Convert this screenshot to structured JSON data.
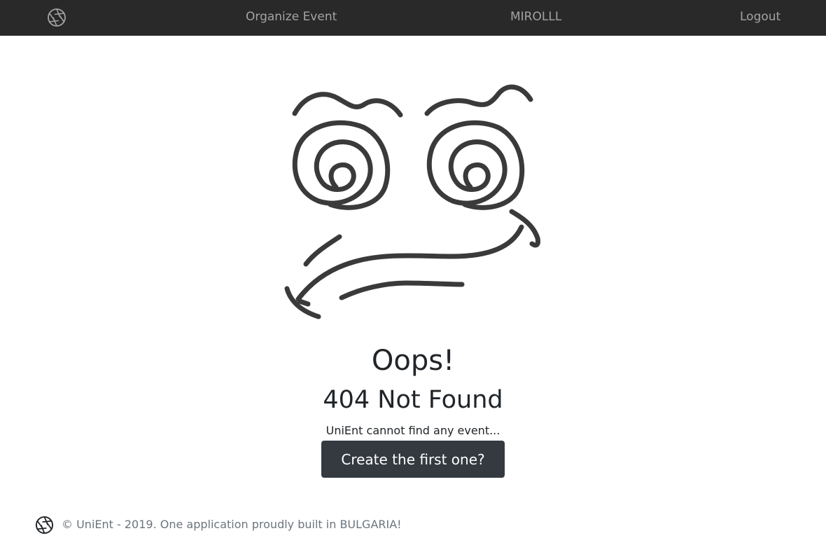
{
  "navbar": {
    "logo_icon": "aperture-icon",
    "links": [
      "Organize Event",
      "MIROLLL",
      "Logout"
    ]
  },
  "illustration": {
    "icon": "confused-face-icon",
    "stroke_color": "#3a3a3a"
  },
  "main": {
    "heading": "Oops!",
    "subheading": "404 Not Found",
    "message": "UniEnt cannot find any event...",
    "cta_label": "Create the first one?"
  },
  "footer": {
    "logo_icon": "aperture-icon",
    "text": "© UniEnt - 2019. One application proudly built in BULGARIA!"
  },
  "colors": {
    "navbar_bg": "#292929",
    "nav_text": "#a3a3a3",
    "button_bg": "#343a40",
    "footer_text": "#6c757d"
  }
}
